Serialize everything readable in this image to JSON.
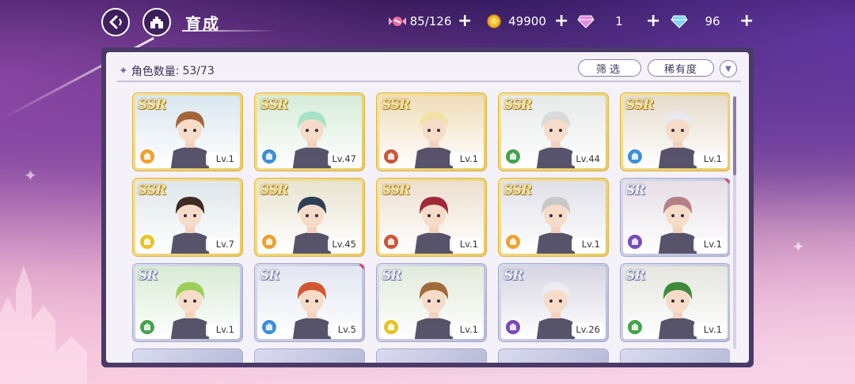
{
  "header": {
    "title": "育成",
    "currencies": [
      {
        "icon": "candy-icon",
        "value": "85/126"
      },
      {
        "icon": "gold-coin-icon",
        "value": "49900"
      },
      {
        "icon": "pink-diamond-icon",
        "value": "1"
      },
      {
        "icon": "blue-diamond-icon",
        "value": "96"
      }
    ],
    "plus_label": "+"
  },
  "panel": {
    "count_label": "角色数量",
    "count_sep": ":",
    "count_value": "53/73",
    "filter_label": "筛选",
    "rarity_label": "稀有度"
  },
  "cards": [
    {
      "rarity": "SSR",
      "level": "Lv.1",
      "element": "orange",
      "hair": "#a4643a",
      "bg": "#d9e7f0",
      "new": false
    },
    {
      "rarity": "SSR",
      "level": "Lv.47",
      "element": "blue",
      "hair": "#a8e3c9",
      "bg": "#d6ecd9",
      "new": false
    },
    {
      "rarity": "SSR",
      "level": "Lv.1",
      "element": "red",
      "hair": "#f0e3a5",
      "bg": "#f0ddb9",
      "new": false
    },
    {
      "rarity": "SSR",
      "level": "Lv.44",
      "element": "green",
      "hair": "#dadada",
      "bg": "#e6eae8",
      "new": false
    },
    {
      "rarity": "SSR",
      "level": "Lv.1",
      "element": "blue",
      "hair": "#e8e8ef",
      "bg": "#e6dccd",
      "new": false
    },
    {
      "rarity": "SSR",
      "level": "Lv.7",
      "element": "yellow",
      "hair": "#3d2b24",
      "bg": "#dfe7ea",
      "new": false
    },
    {
      "rarity": "SSR",
      "level": "Lv.45",
      "element": "orange",
      "hair": "#2c3f55",
      "bg": "#e8e4d0",
      "new": false
    },
    {
      "rarity": "SSR",
      "level": "Lv.1",
      "element": "red",
      "hair": "#a0283a",
      "bg": "#eddfcf",
      "new": false
    },
    {
      "rarity": "SSR",
      "level": "Lv.1",
      "element": "orange",
      "hair": "#c8c8c8",
      "bg": "#dfe1e8",
      "new": false
    },
    {
      "rarity": "SR",
      "level": "Lv.1",
      "element": "purple",
      "hair": "#b67e86",
      "bg": "#e6dfe6",
      "new": true
    },
    {
      "rarity": "SR",
      "level": "Lv.1",
      "element": "green",
      "hair": "#9ccf56",
      "bg": "#d8ebd4",
      "new": false
    },
    {
      "rarity": "SR",
      "level": "Lv.5",
      "element": "blue",
      "hair": "#d4552f",
      "bg": "#e1e7f0",
      "new": true
    },
    {
      "rarity": "SR",
      "level": "Lv.1",
      "element": "yellow",
      "hair": "#a06a3a",
      "bg": "#e2eadb",
      "new": false
    },
    {
      "rarity": "SR",
      "level": "Lv.26",
      "element": "purple",
      "hair": "#ececf3",
      "bg": "#d7d5e2",
      "new": false
    },
    {
      "rarity": "SR",
      "level": "Lv.1",
      "element": "green",
      "hair": "#3d8a3a",
      "bg": "#e5e6de",
      "new": false
    }
  ],
  "element_colors": {
    "orange": "#f0a030",
    "blue": "#3d8fd8",
    "red": "#c9583a",
    "green": "#45a24e",
    "yellow": "#e6c326",
    "purple": "#7a4ab8"
  }
}
